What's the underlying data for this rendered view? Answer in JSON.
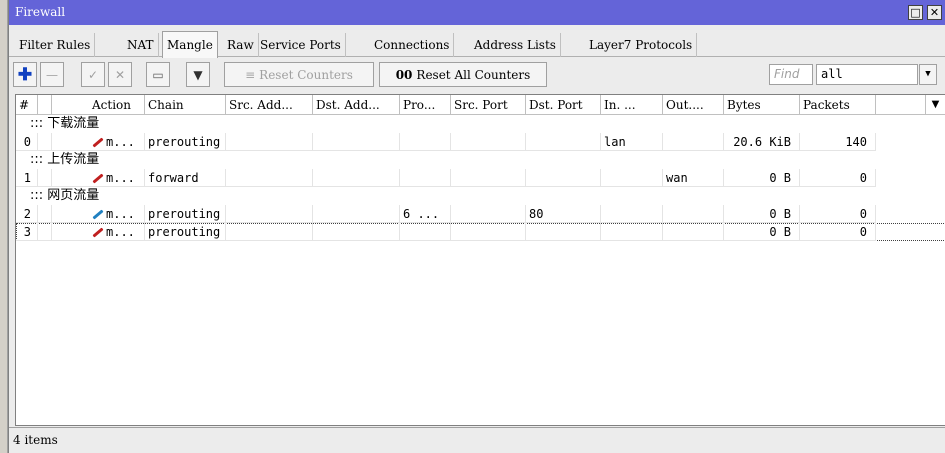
{
  "window": {
    "title": "Firewall",
    "restore_glyph": "□",
    "close_glyph": "✕"
  },
  "tabs": [
    {
      "label": "Filter Rules"
    },
    {
      "label": "NAT"
    },
    {
      "label": "Mangle"
    },
    {
      "label": "Raw"
    },
    {
      "label": "Service Ports"
    },
    {
      "label": "Connections"
    },
    {
      "label": "Address Lists"
    },
    {
      "label": "Layer7 Protocols"
    }
  ],
  "toolbar": {
    "add_glyph": "✚",
    "remove_glyph": "—",
    "enable_glyph": "✓",
    "disable_glyph": "✕",
    "comment_glyph": "▭",
    "filter_glyph": "▼",
    "reset_counters_label": "Reset Counters",
    "reset_all_icon": "00",
    "reset_all_label": "Reset All Counters",
    "find_placeholder": "Find",
    "filter_value": "all",
    "dropdown_glyph": "▼"
  },
  "columns": [
    "#",
    "Action",
    "Chain",
    "Src. Add...",
    "Dst. Add...",
    "Pro...",
    "Src. Port",
    "Dst. Port",
    "In. ...",
    "Out....",
    "Bytes",
    "Packets"
  ],
  "table": {
    "comments": [
      "::: 下载流量",
      "::: 上传流量",
      "::: 网页流量"
    ],
    "rows": [
      {
        "num": "0",
        "action": "m...",
        "chain": "prerouting",
        "src": "",
        "dst": "",
        "proto": "",
        "sport": "",
        "dport": "",
        "in": "lan",
        "out": "",
        "bytes": "20.6 KiB",
        "packets": "140",
        "icon_color": "#c02020"
      },
      {
        "num": "1",
        "action": "m...",
        "chain": "forward",
        "src": "",
        "dst": "",
        "proto": "",
        "sport": "",
        "dport": "",
        "in": "",
        "out": "wan",
        "bytes": "0 B",
        "packets": "0",
        "icon_color": "#c02020"
      },
      {
        "num": "2",
        "action": "m...",
        "chain": "prerouting",
        "src": "",
        "dst": "",
        "proto": "6 ...",
        "sport": "",
        "dport": "80",
        "in": "",
        "out": "",
        "bytes": "0 B",
        "packets": "0",
        "icon_color": "#2080c0"
      },
      {
        "num": "3",
        "action": "m...",
        "chain": "prerouting",
        "src": "",
        "dst": "",
        "proto": "",
        "sport": "",
        "dport": "",
        "in": "",
        "out": "",
        "bytes": "0 B",
        "packets": "0",
        "icon_color": "#c02020"
      }
    ]
  },
  "status": {
    "items_text": "4 items"
  },
  "colors": {
    "titlebar": "#6464d8",
    "accent_add": "#1040c0"
  }
}
